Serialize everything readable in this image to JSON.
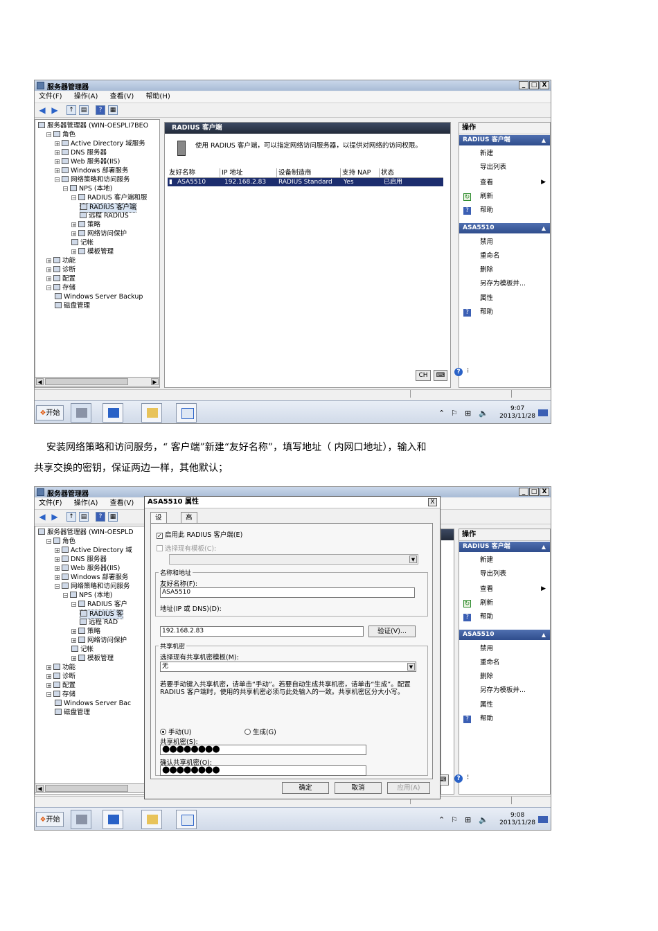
{
  "shot1": {
    "window_title": "服务器管理器",
    "window_buttons": [
      "_",
      "□",
      "X"
    ],
    "menu": [
      "文件(F)",
      "操作(A)",
      "查看(V)",
      "帮助(H)"
    ],
    "tree": [
      {
        "label": "服务器管理器 (WIN-OESPLI7BEO",
        "indent": 0
      },
      {
        "label": "角色",
        "indent": 1,
        "exp": "⊟"
      },
      {
        "label": "Active Directory 域服务",
        "indent": 2,
        "exp": "⊞"
      },
      {
        "label": "DNS 服务器",
        "indent": 2,
        "exp": "⊞"
      },
      {
        "label": "Web 服务器(IIS)",
        "indent": 2,
        "exp": "⊞"
      },
      {
        "label": "Windows 部署服务",
        "indent": 2,
        "exp": "⊞"
      },
      {
        "label": "网络策略和访问服务",
        "indent": 2,
        "exp": "⊟"
      },
      {
        "label": "NPS (本地)",
        "indent": 3,
        "exp": "⊟"
      },
      {
        "label": "RADIUS 客户端和服",
        "indent": 4,
        "exp": "⊟"
      },
      {
        "label": "RADIUS 客户端",
        "indent": 5,
        "sel": true
      },
      {
        "label": "远程 RADIUS",
        "indent": 5
      },
      {
        "label": "策略",
        "indent": 4,
        "exp": "⊞"
      },
      {
        "label": "网络访问保护",
        "indent": 4,
        "exp": "⊞"
      },
      {
        "label": "记帐",
        "indent": 4
      },
      {
        "label": "模板管理",
        "indent": 4,
        "exp": "⊞"
      },
      {
        "label": "功能",
        "indent": 1,
        "exp": "⊞"
      },
      {
        "label": "诊断",
        "indent": 1,
        "exp": "⊞"
      },
      {
        "label": "配置",
        "indent": 1,
        "exp": "⊞"
      },
      {
        "label": "存储",
        "indent": 1,
        "exp": "⊟"
      },
      {
        "label": "Windows Server Backup",
        "indent": 2
      },
      {
        "label": "磁盘管理",
        "indent": 2
      }
    ],
    "center_header": "RADIUS 客户端",
    "description": "使用 RADIUS 客户端，可以指定网络访问服务器，以提供对网络的访问权限。",
    "columns": [
      "友好名称",
      "IP 地址",
      "设备制造商",
      "支持 NAP",
      "状态"
    ],
    "row": [
      "ASA5510",
      "192.168.2.83",
      "RADIUS Standard",
      "Yes",
      "已启用"
    ],
    "actions_header": "操作",
    "action_sec1": "RADIUS 客户端",
    "action_sec1_items": [
      "新建",
      "导出列表",
      "查看",
      "刷新",
      "帮助"
    ],
    "action_sec2": "ASA5510",
    "action_sec2_items": [
      "禁用",
      "重命名",
      "删除",
      "另存为模板并...",
      "属性",
      "帮助"
    ],
    "lang_indicator": "CH",
    "taskbar_start": "开始",
    "clock_time": "9:07",
    "clock_date": "2013/11/28"
  },
  "paragraph": {
    "line1": "安装网络策略和访问服务，“          客户端”新建“友好名称”，填写地址（          内网口地址），输入和",
    "line2": "共享交换的密钥，保证两边一样，其他默认；"
  },
  "shot2": {
    "window_title": "服务器管理器",
    "window_buttons": [
      "_",
      "□",
      "X"
    ],
    "menu": [
      "文件(F)",
      "操作(A)",
      "查看(V)"
    ],
    "tree": [
      {
        "label": "服务器管理器 (WIN-OESPLD",
        "indent": 0
      },
      {
        "label": "角色",
        "indent": 1,
        "exp": "⊟"
      },
      {
        "label": "Active Directory 域",
        "indent": 2,
        "exp": "⊞"
      },
      {
        "label": "DNS 服务器",
        "indent": 2,
        "exp": "⊞"
      },
      {
        "label": "Web 服务器(IIS)",
        "indent": 2,
        "exp": "⊞"
      },
      {
        "label": "Windows 部署服务",
        "indent": 2,
        "exp": "⊞"
      },
      {
        "label": "网络策略和访问服务",
        "indent": 2,
        "exp": "⊟"
      },
      {
        "label": "NPS (本地)",
        "indent": 3,
        "exp": "⊟"
      },
      {
        "label": "RADIUS 客户",
        "indent": 4,
        "exp": "⊟"
      },
      {
        "label": "RADIUS 客",
        "indent": 5,
        "sel": true
      },
      {
        "label": "远程 RAD",
        "indent": 5
      },
      {
        "label": "策略",
        "indent": 4,
        "exp": "⊞"
      },
      {
        "label": "网络访问保护",
        "indent": 4,
        "exp": "⊞"
      },
      {
        "label": "记帐",
        "indent": 4
      },
      {
        "label": "模板管理",
        "indent": 4,
        "exp": "⊞"
      },
      {
        "label": "功能",
        "indent": 1,
        "exp": "⊞"
      },
      {
        "label": "诊断",
        "indent": 1,
        "exp": "⊞"
      },
      {
        "label": "配置",
        "indent": 1,
        "exp": "⊞"
      },
      {
        "label": "存储",
        "indent": 1,
        "exp": "⊟"
      },
      {
        "label": "Windows Server Bac",
        "indent": 2
      },
      {
        "label": "磁盘管理",
        "indent": 2
      }
    ],
    "actions_header": "操作",
    "action_sec1": "RADIUS 客户端",
    "action_sec1_items": [
      "新建",
      "导出列表",
      "查看",
      "刷新",
      "帮助"
    ],
    "action_sec2": "ASA5510",
    "action_sec2_items": [
      "禁用",
      "重命名",
      "删除",
      "另存为模板并...",
      "属性",
      "帮助"
    ],
    "lang_indicator": "CH",
    "taskbar_start": "开始",
    "clock_time": "9:08",
    "clock_date": "2013/11/28",
    "dialog": {
      "title": "ASA5510 属性",
      "close": "X",
      "tabs": [
        "设置",
        "高级"
      ],
      "enable_checkbox": "启用此 RADIUS 客户端(E)",
      "existing_template": "选择现有模板(C):",
      "group_name": "名称和地址",
      "friendly_label": "友好名称(F):",
      "friendly_value": "ASA5510",
      "address_label": "地址(IP 或 DNS)(D):",
      "address_value": "192.168.2.83",
      "verify_button": "验证(V)...",
      "group_secret": "共享机密",
      "secret_template_label": "选择现有共享机密模板(M):",
      "secret_template_value": "无",
      "secret_help": "若要手动键入共享机密，请单击“手动”。若要自动生成共享机密，请单击“生成”。配置 RADIUS 客户端时，使用的共享机密必须与此处输入的一致。共享机密区分大小写。",
      "radio_manual": "手动(U)",
      "radio_generate": "生成(G)",
      "secret_label": "共享机密(S):",
      "secret_value": "●●●●●●●●",
      "confirm_label": "确认共享机密(O):",
      "confirm_value": "●●●●●●●●",
      "ok": "确定",
      "cancel": "取消",
      "apply": "应用(A)"
    }
  }
}
